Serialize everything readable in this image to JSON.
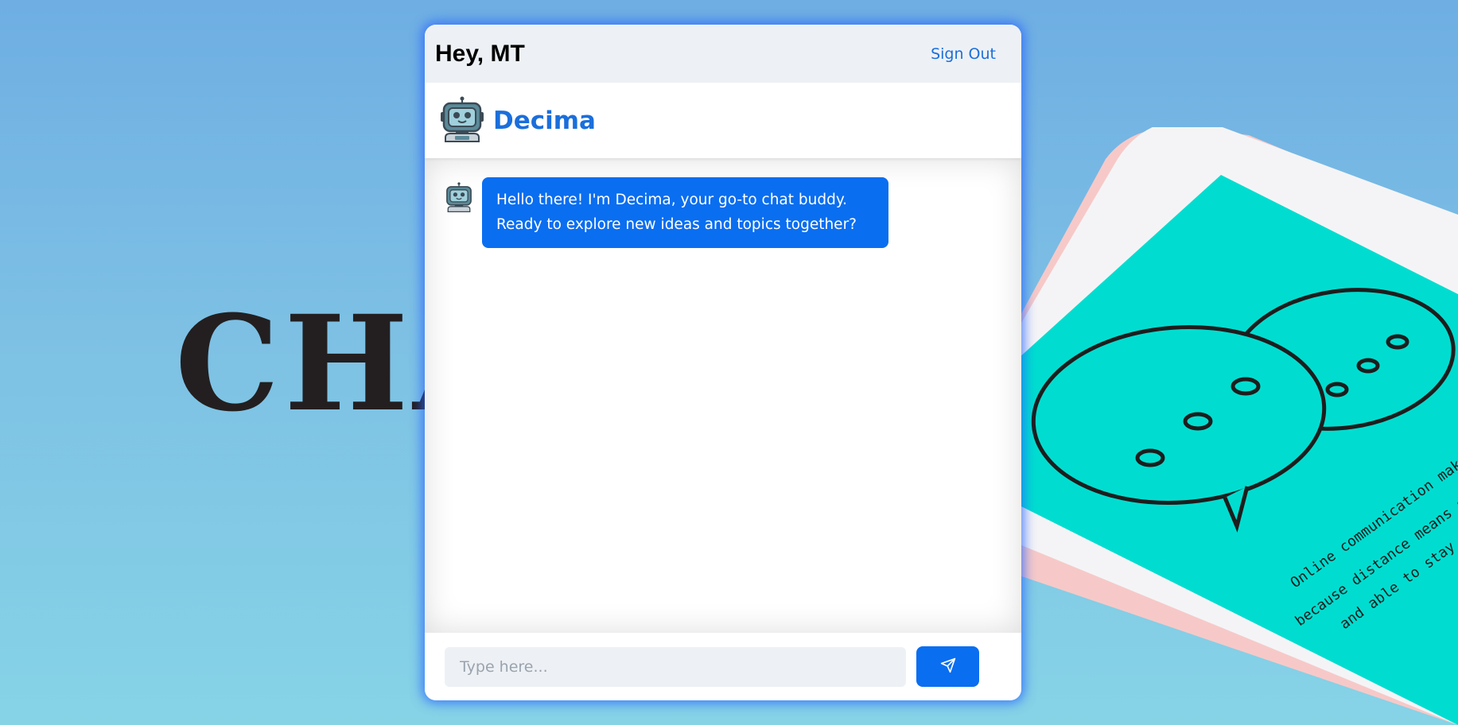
{
  "background": {
    "headline": "CHA",
    "phone_caption_lines": [
      "Online communication makes li",
      "because distance means so lit",
      "and able to stay in t"
    ]
  },
  "header": {
    "greeting": "Hey, MT",
    "sign_out_label": "Sign Out"
  },
  "bot": {
    "name": "Decima",
    "avatar_icon": "robot-icon"
  },
  "messages": [
    {
      "sender": "bot",
      "text": "Hello there! I'm Decima, your go-to chat buddy. Ready to explore new ideas and topics together?"
    }
  ],
  "composer": {
    "placeholder": "Type here...",
    "value": "",
    "send_icon": "paper-plane-icon"
  },
  "colors": {
    "accent": "#0a6ef0",
    "header_bg": "#edf1f5",
    "phone_screen": "#00ddd0"
  }
}
